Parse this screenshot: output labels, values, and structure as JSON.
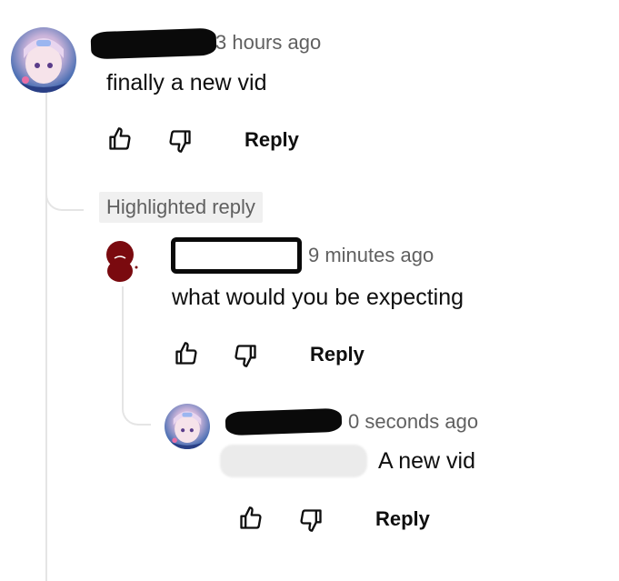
{
  "comment": {
    "timestamp": "3 hours ago",
    "text": "finally a new vid",
    "reply_label": "Reply",
    "like_icon": "thumbs-up-icon",
    "dislike_icon": "thumbs-down-icon"
  },
  "highlighted_label": "Highlighted reply",
  "reply1": {
    "timestamp": "9 minutes ago",
    "text": "what would you be expecting",
    "reply_label": "Reply"
  },
  "reply2": {
    "timestamp": "0 seconds ago",
    "text": "A new vid",
    "reply_label": "Reply"
  },
  "colors": {
    "meta_text": "#606060",
    "body_text": "#0f0f0f",
    "badge_bg": "#f0f0f0",
    "thread_line": "#e5e5e5"
  }
}
